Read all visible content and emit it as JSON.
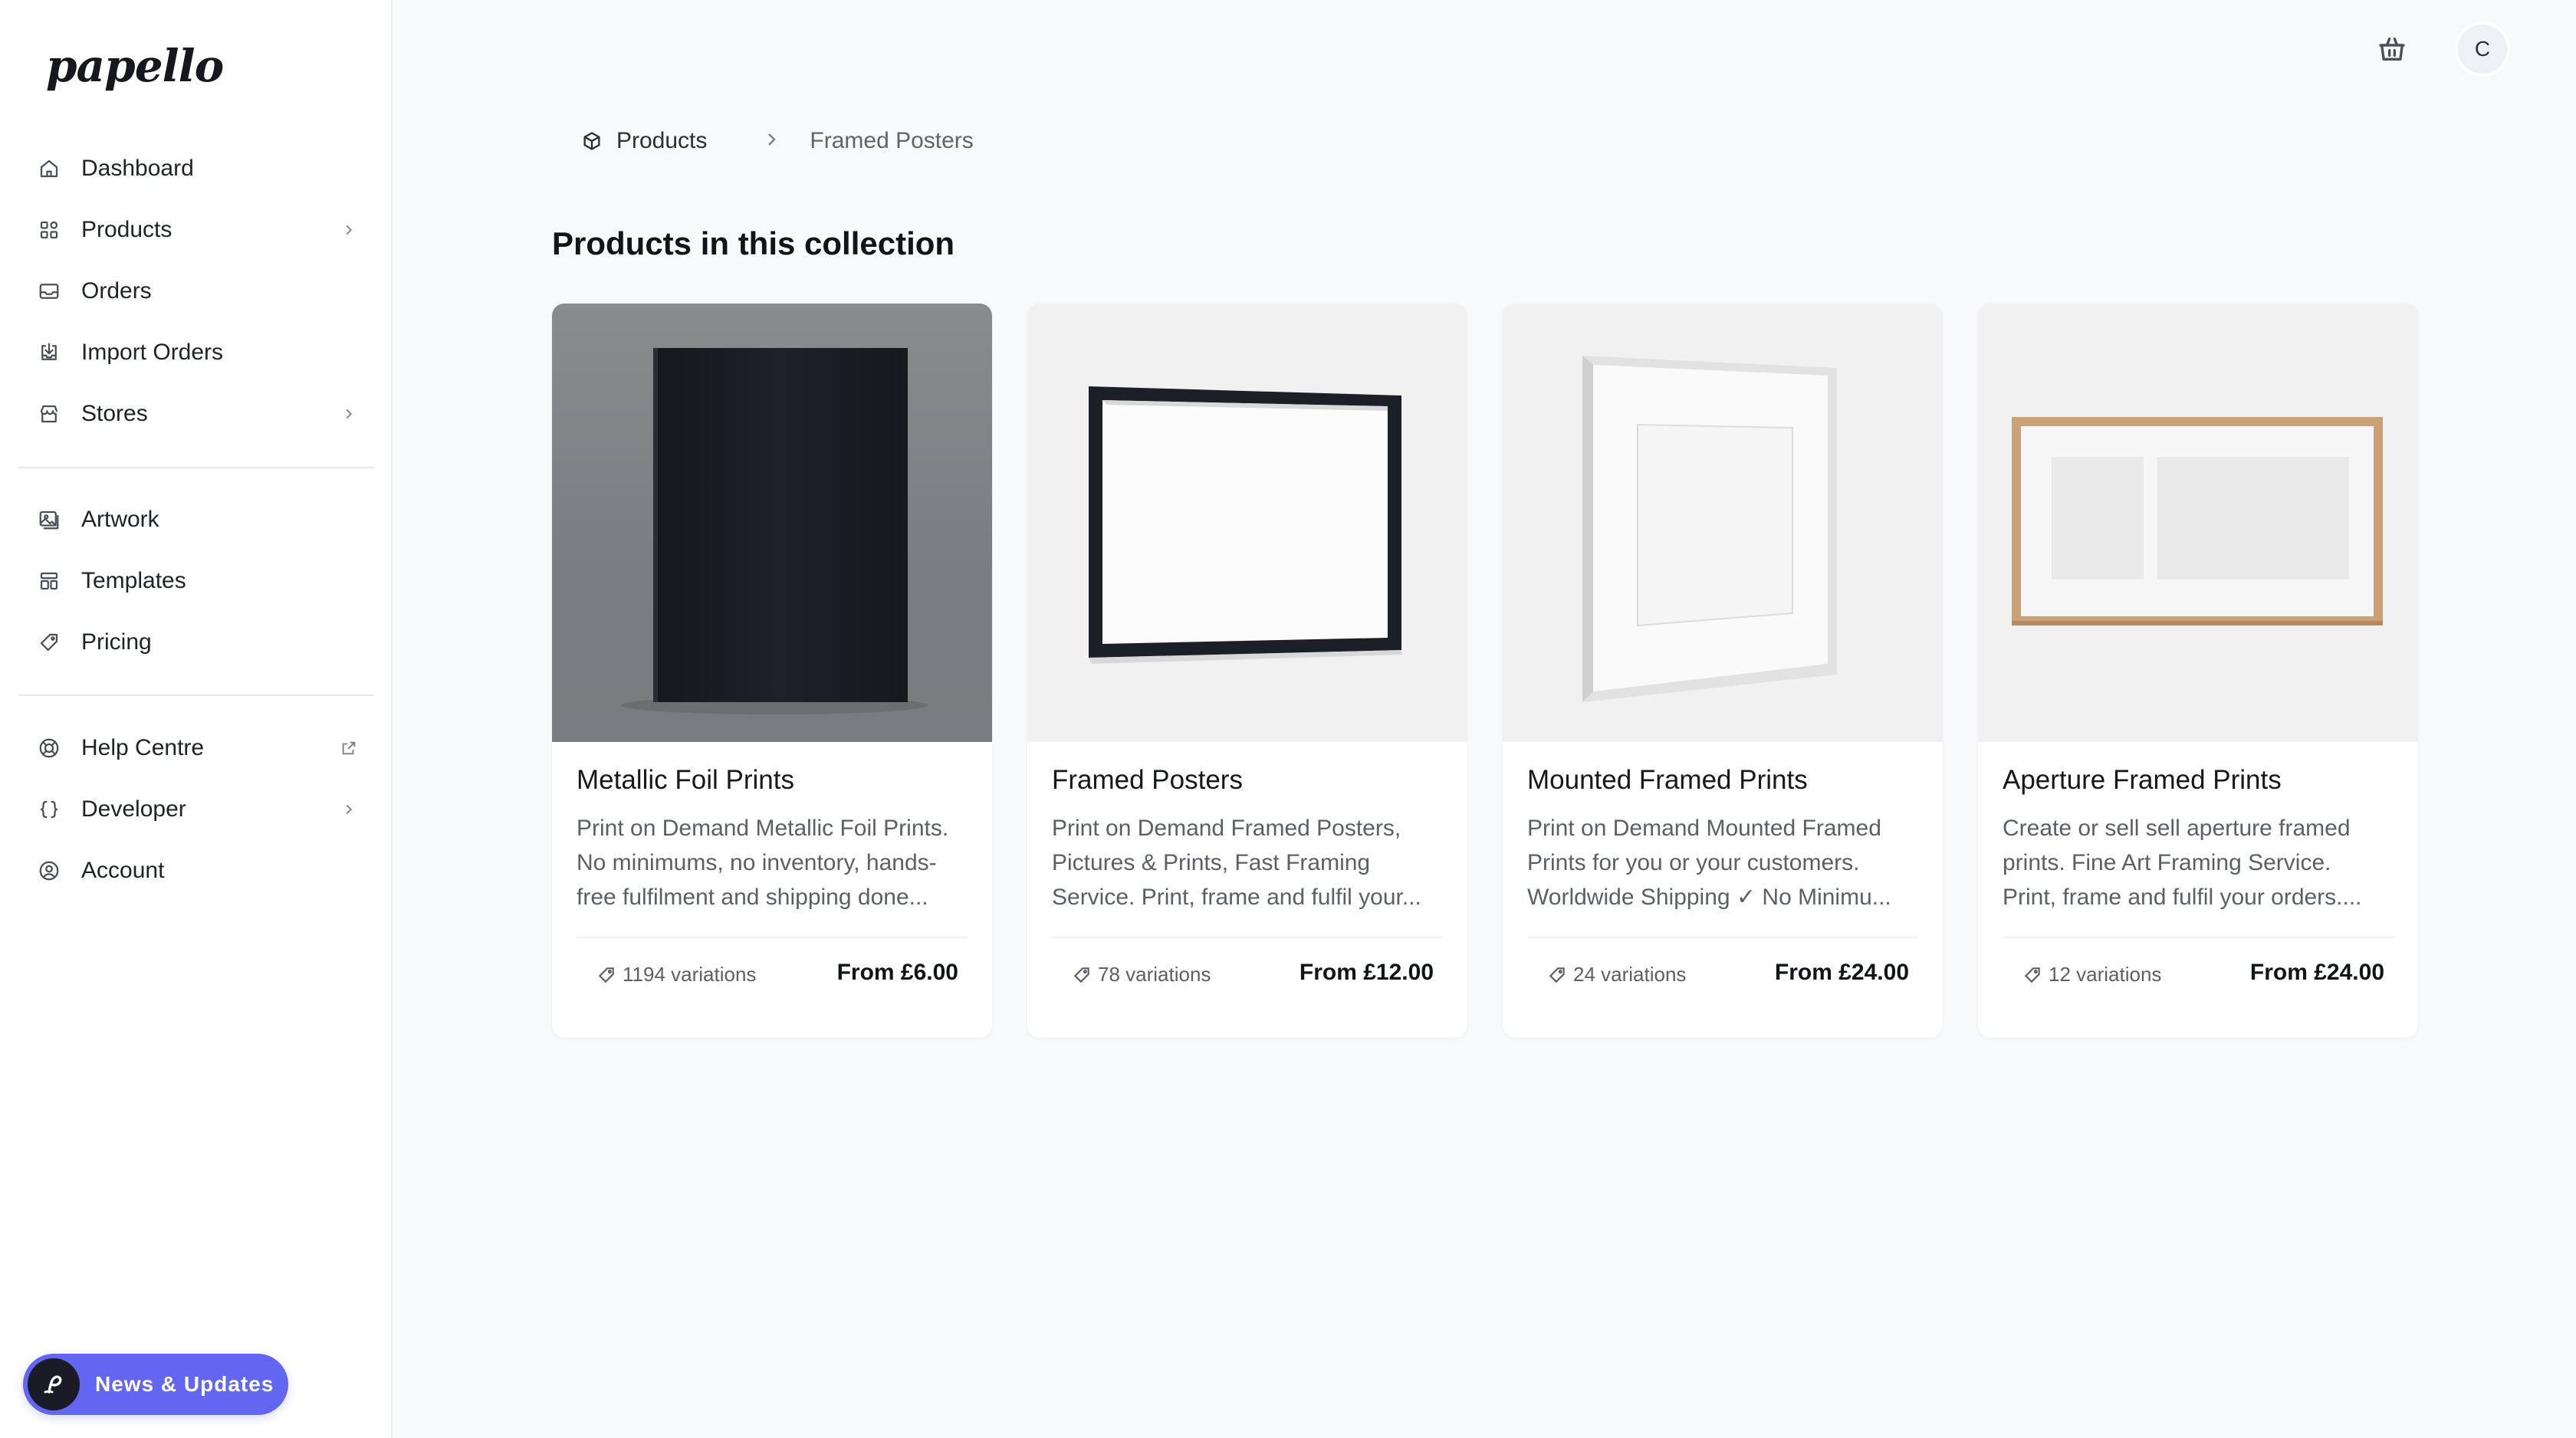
{
  "brand": {
    "logo_text": "papello"
  },
  "sidebar": {
    "primary": [
      {
        "label": "Dashboard",
        "icon": "home-icon",
        "has_chevron": false
      },
      {
        "label": "Products",
        "icon": "grid-icon",
        "has_chevron": true
      },
      {
        "label": "Orders",
        "icon": "inbox-icon",
        "has_chevron": false
      },
      {
        "label": "Import Orders",
        "icon": "import-icon",
        "has_chevron": false
      },
      {
        "label": "Stores",
        "icon": "store-icon",
        "has_chevron": true
      }
    ],
    "secondary": [
      {
        "label": "Artwork",
        "icon": "image-icon"
      },
      {
        "label": "Templates",
        "icon": "template-icon"
      },
      {
        "label": "Pricing",
        "icon": "tag-icon"
      }
    ],
    "tertiary": [
      {
        "label": "Help Centre",
        "icon": "lifebuoy-icon",
        "trailing": "external-link-icon"
      },
      {
        "label": "Developer",
        "icon": "braces-icon",
        "trailing": "chevron-right-icon"
      },
      {
        "label": "Account",
        "icon": "user-circle-icon",
        "trailing": ""
      }
    ],
    "news_button": {
      "label": "News & Updates",
      "color": "#6366f1"
    }
  },
  "topbar": {
    "avatar_initial": "C"
  },
  "breadcrumb": {
    "root": "Products",
    "current": "Framed Posters"
  },
  "main": {
    "title": "Products in this collection",
    "products": [
      {
        "title": "Metallic Foil Prints",
        "description": [
          "Print on Demand Metallic Foil Prints.",
          "No minimums, no inventory, hands-",
          "free fulfilment and shipping done..."
        ],
        "variations": "1194 variations",
        "price": "From £6.00"
      },
      {
        "title": "Framed Posters",
        "description": [
          "Print on Demand Framed Posters,",
          "Pictures & Prints, Fast Framing",
          "Service. Print, frame and fulfil your..."
        ],
        "variations": "78 variations",
        "price": "From £12.00"
      },
      {
        "title": "Mounted Framed Prints",
        "description": [
          "Print on Demand Mounted Framed",
          "Prints for you or your customers.",
          "Worldwide Shipping ✓ No Minimu..."
        ],
        "variations": "24 variations",
        "price": "From £24.00"
      },
      {
        "title": "Aperture Framed Prints",
        "description": [
          "Create or sell sell aperture framed",
          "prints. Fine Art Framing Service.",
          "Print, frame and fulfil your orders...."
        ],
        "variations": "12 variations",
        "price": "From £24.00"
      }
    ]
  }
}
